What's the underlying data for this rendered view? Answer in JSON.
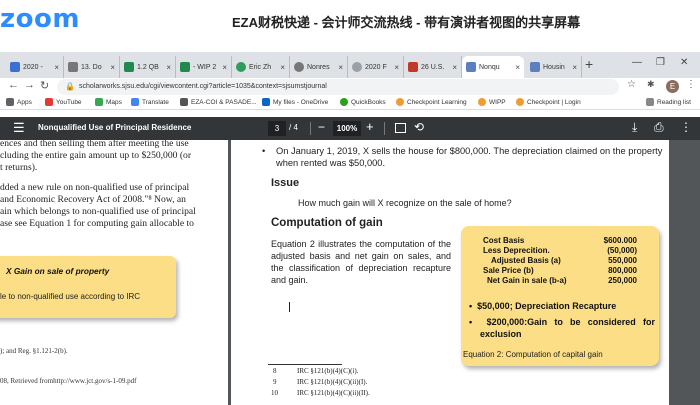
{
  "zoom": {
    "logo": "zoom",
    "title": "EZA财税快递 - 会计师交流热线 - 带有演讲者视图的共享屏幕",
    "brand_color": "#2d8cff"
  },
  "browser": {
    "tabs": [
      {
        "label": "2020 -",
        "icon_color": "#3b6fd4"
      },
      {
        "label": "13. Do",
        "icon_color": "#777777"
      },
      {
        "label": "1.2 QB",
        "icon_color": "#1f8a4c"
      },
      {
        "label": "- WIP 2",
        "icon_color": "#1f8a4c"
      },
      {
        "label": "Eric Zh",
        "icon_color": "#2e9d5b"
      },
      {
        "label": "Nonres",
        "icon_color": "#777777"
      },
      {
        "label": "2020 F",
        "icon_color": "#9aa0a6"
      },
      {
        "label": "26 U.S.",
        "icon_color": "#c0392b"
      },
      {
        "label": "Nonqu",
        "icon_color": "#5b7fbf"
      },
      {
        "label": "Housin",
        "icon_color": "#5b7fbf"
      }
    ],
    "new_tab": "+",
    "url": "scholarworks.sjsu.edu/cgi/viewcontent.cgi?article=1035&context=sjsumstjournal",
    "avatar_letter": "E",
    "bookmarks": [
      {
        "label": "Apps",
        "icon_color": "#5f6368"
      },
      {
        "label": "YouTube",
        "icon_color": "#e53935"
      },
      {
        "label": "Maps",
        "icon_color": "#34a853"
      },
      {
        "label": "Translate",
        "icon_color": "#4285f4"
      },
      {
        "label": "EZA-COI & PASADE...",
        "icon_color": "#555555"
      },
      {
        "label": "My files - OneDrive",
        "icon_color": "#0a66c2"
      },
      {
        "label": "QuickBooks",
        "icon_color": "#2ca01c"
      },
      {
        "label": "Checkpoint Learning",
        "icon_color": "#f29b30"
      },
      {
        "label": "WIPP",
        "icon_color": "#f29b30"
      },
      {
        "label": "Checkpoint | Login",
        "icon_color": "#f29b30"
      }
    ],
    "reading_list": "Reading list"
  },
  "pdf": {
    "title": "Nonqualified Use of Principal Residence",
    "current_page": "3",
    "total_pages": "/ 4",
    "zoom": "100%"
  },
  "left_page": {
    "lines": [
      "ences and then selling them after meeting the use",
      "cluding the entire gain amount up to $250,000 (or",
      "t returns).",
      "dded a new rule on non-qualified use of principal",
      "and Economic Recovery Act of 2008.\"⁸   Now, an",
      "ain which belongs to non-qualified use of principal",
      "ase see Equation 1 for computing gain allocable to"
    ],
    "box_title": "X  Gain on sale of property",
    "box_text": "le to non-qualified use according to IRC",
    "footnotes": [
      "); and Reg. §1.121-2(b).",
      "08, Retrieved fromhttp://www.jct.gov/s-1-09.pdf"
    ]
  },
  "right_page": {
    "bullet": "On January 1, 2019, X sells the house for $800,000. The depreciation claimed on the property when rented was $50,000.",
    "issue_heading": "Issue",
    "issue_question": "How much gain will X recognize on the sale of home?",
    "computation_heading": "Computation of gain",
    "equation_text": "Equation 2 illustrates the computation of the adjusted basis and net gain on sales, and the classification of depreciation recapture and gain.",
    "calc": [
      {
        "label": "Cost Basis",
        "value": "$600.000"
      },
      {
        "label": "Less Deprecition.",
        "value": "(50,000)"
      },
      {
        "label": "Adjusted Basis (a)",
        "value": "550,000"
      },
      {
        "label": "Sale Price (b)",
        "value": "800,000"
      },
      {
        "label": "Net Gain in sale (b-a)",
        "value": "250,000"
      }
    ],
    "bullets": [
      "$50,000; Depreciation Recapture",
      "$200,000:Gain to be considered for exclusion"
    ],
    "caption": "Equation 2: Computation of capital gain",
    "footnotes": [
      {
        "num": "8",
        "text": "IRC §121(b)(4)(C)(i)."
      },
      {
        "num": "9",
        "text": "IRC §121(b)(4)(C)(ii)(I)."
      },
      {
        "num": "10",
        "text": "IRC §121(b)(4)(C)(ii)(II)."
      }
    ]
  }
}
